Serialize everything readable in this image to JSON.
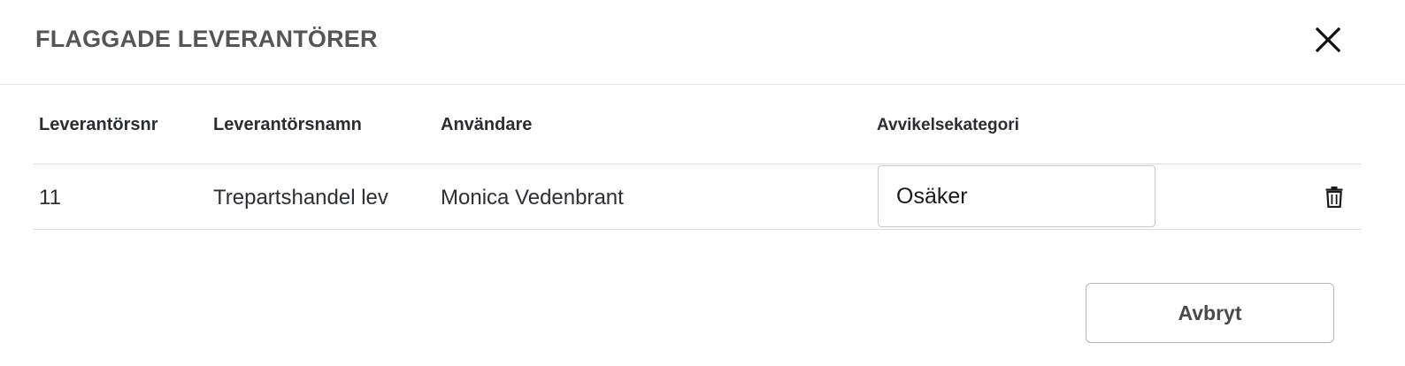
{
  "dialog": {
    "title": "FLAGGADE LEVERANTÖRER",
    "close_icon": "close-icon"
  },
  "table": {
    "columns": [
      "Leverantörsnr",
      "Leverantörsnamn",
      "Användare",
      "Avvikelsekategori"
    ],
    "rows": [
      {
        "supplier_nr": "11",
        "supplier_name": "Trepartshandel lev",
        "user": "Monica Vedenbrant",
        "category": "Osäker",
        "delete_icon": "trash-icon"
      }
    ]
  },
  "footer": {
    "cancel_label": "Avbryt"
  }
}
